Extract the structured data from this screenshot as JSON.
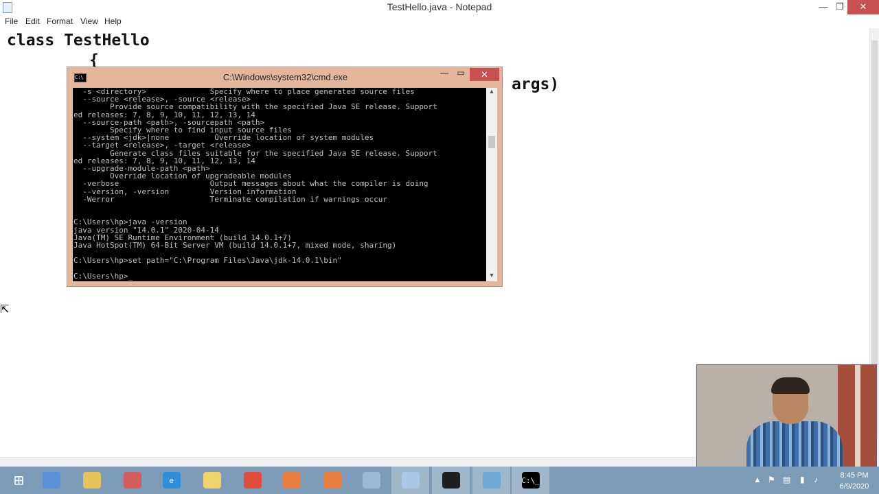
{
  "notepad": {
    "title": "TestHello.java - Notepad",
    "controls": {
      "minimize": "—",
      "maximize": "❐",
      "close": "✕"
    },
    "menu": [
      "File",
      "Edit",
      "Format",
      "View",
      "Help"
    ],
    "code": {
      "line1": "class TestHello",
      "line2": "{",
      "line3_visible": "args)"
    }
  },
  "cmd": {
    "title": "C:\\Windows\\system32\\cmd.exe",
    "controls": {
      "minimize": "—",
      "maximize": "▭",
      "close": "✕"
    },
    "lines": [
      "  -s <directory>              Specify where to place generated source files",
      "  --source <release>, -source <release>",
      "        Provide source compatibility with the specified Java SE release. Support",
      "ed releases: 7, 8, 9, 10, 11, 12, 13, 14",
      "  --source-path <path>, -sourcepath <path>",
      "        Specify where to find input source files",
      "  --system <jdk>|none          Override location of system modules",
      "  --target <release>, -target <release>",
      "        Generate class files suitable for the specified Java SE release. Support",
      "ed releases: 7, 8, 9, 10, 11, 12, 13, 14",
      "  --upgrade-module-path <path>",
      "        Override location of upgradeable modules",
      "  -verbose                    Output messages about what the compiler is doing",
      "  --version, -version         Version information",
      "  -Werror                     Terminate compilation if warnings occur",
      "",
      "",
      "C:\\Users\\hp>java -version",
      "java version \"14.0.1\" 2020-04-14",
      "Java(TM) SE Runtime Environment (build 14.0.1+7)",
      "Java HotSpot(TM) 64-Bit Server VM (build 14.0.1+7, mixed mode, sharing)",
      "",
      "C:\\Users\\hp>set path=\"C:\\Program Files\\Java\\jdk-14.0.1\\bin\"",
      "",
      "C:\\Users\\hp>_"
    ]
  },
  "taskbar": {
    "apps": [
      {
        "name": "start-button",
        "glyph": "⊞",
        "color": "#ffffff"
      },
      {
        "name": "calculator",
        "glyph": "",
        "color": "#5b8fd6"
      },
      {
        "name": "file-explorer",
        "glyph": "",
        "color": "#e8c35a"
      },
      {
        "name": "paint",
        "glyph": "",
        "color": "#d65c5c"
      },
      {
        "name": "internet-explorer",
        "glyph": "e",
        "color": "#2e8fdc"
      },
      {
        "name": "folder-app",
        "glyph": "",
        "color": "#f2d16b"
      },
      {
        "name": "chrome",
        "glyph": "",
        "color": "#e04b3b"
      },
      {
        "name": "recorder-app",
        "glyph": "",
        "color": "#e87c3b"
      },
      {
        "name": "screenshot-app",
        "glyph": "",
        "color": "#e87c3b"
      },
      {
        "name": "paint-3d",
        "glyph": "",
        "color": "#9bb8d6"
      },
      {
        "name": "notepad",
        "glyph": "",
        "color": "#a9c8e8"
      },
      {
        "name": "pycharm",
        "glyph": "",
        "color": "#1f1f1f"
      },
      {
        "name": "control-panel",
        "glyph": "",
        "color": "#6fa9d8"
      },
      {
        "name": "cmd",
        "glyph": "C:\\_",
        "color": "#000000"
      }
    ],
    "tray": {
      "arrow": "▲",
      "time": "8:45 PM",
      "date": "6/9/2020"
    }
  }
}
